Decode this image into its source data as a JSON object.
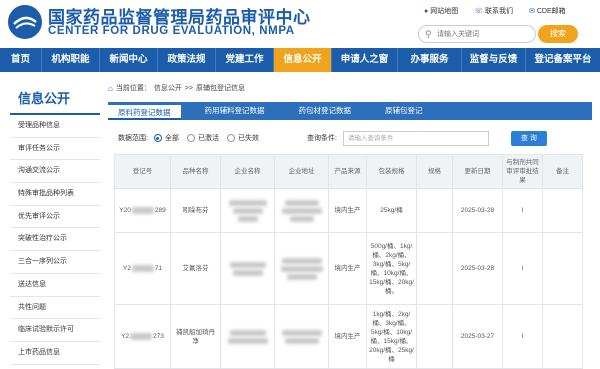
{
  "header": {
    "site_name_cn": "国家药品监督管理局药品审评中心",
    "site_name_en": "CENTER FOR DRUG EVALUATION, NMPA",
    "links": [
      "网站地图",
      "联系我们",
      "CDE邮箱"
    ],
    "search_placeholder": "请输入关键词",
    "search_button": "搜索"
  },
  "nav": [
    "首页",
    "机构职能",
    "新闻中心",
    "政策法规",
    "党建工作",
    "信息公开",
    "申请人之窗",
    "办事服务",
    "监督与反馈",
    "登记备案平台"
  ],
  "nav_active": "信息公开",
  "sidebar": {
    "title": "信息公开",
    "items": [
      "受理品种信息",
      "审评任务公示",
      "沟通交流公示",
      "特殊审批品种列表",
      "优先审评公示",
      "突破性治疗公示",
      "三合一序列公示",
      "送达信息",
      "共性问题",
      "临床试验默示许可",
      "上市药品信息"
    ]
  },
  "breadcrumb": {
    "prefix": "当前位置：",
    "items": [
      "信息公开",
      ">>",
      "原辅包登记信息"
    ]
  },
  "tabs": [
    "原料药登记数据",
    "药用辅料登记数据",
    "药包材登记数据",
    "原辅包登记"
  ],
  "filter": {
    "label": "数据范围:",
    "options": [
      "全部",
      "已激活",
      "已失效"
    ],
    "selected": "全部",
    "condition_label": "查询条件:",
    "condition_placeholder": "请输入查询条件",
    "query_button": "查 询"
  },
  "table": {
    "headers": [
      "登记号",
      "品种名称",
      "企业名称",
      "企业地址",
      "产品来源",
      "包装规格",
      "规格",
      "更新日期",
      "与制剂共同审评审批结果",
      "备注"
    ],
    "rows": [
      {
        "reg_prefix": "Y20",
        "reg_suffix": "289",
        "name": "吲哚布芬",
        "address_visible": "区\n号",
        "source": "境内生产",
        "package": "25kg/桶",
        "spec": "",
        "date": "2025-03-28",
        "result": "I",
        "note": ""
      },
      {
        "reg_prefix": "Y2",
        "reg_suffix": "71",
        "name": "艾氟洛芬",
        "address_visible": "区\n9号",
        "source": "境内生产",
        "package": "500g/桶、1kg/桶、2kg/桶、3kg/桶、5kg/桶、10kg/桶、15kg/桶、20kg/桶。",
        "spec": "",
        "date": "2025-03-28",
        "result": "I",
        "note": ""
      },
      {
        "reg_prefix": "Y2",
        "reg_suffix": "273",
        "name": "捕凯船加琦丹净",
        "address_visible": "",
        "source": "境内生产",
        "package": "1kg/桶、2kg/桶、3kg/桶、5kg/桶、10kg/桶、15kg/桶、20kg/桶、25kg/桶",
        "spec": "",
        "date": "2025-03-27",
        "result": "I",
        "note": ""
      }
    ]
  },
  "colors": {
    "primary": "#1b5dab",
    "accent": "#f0a41e"
  }
}
